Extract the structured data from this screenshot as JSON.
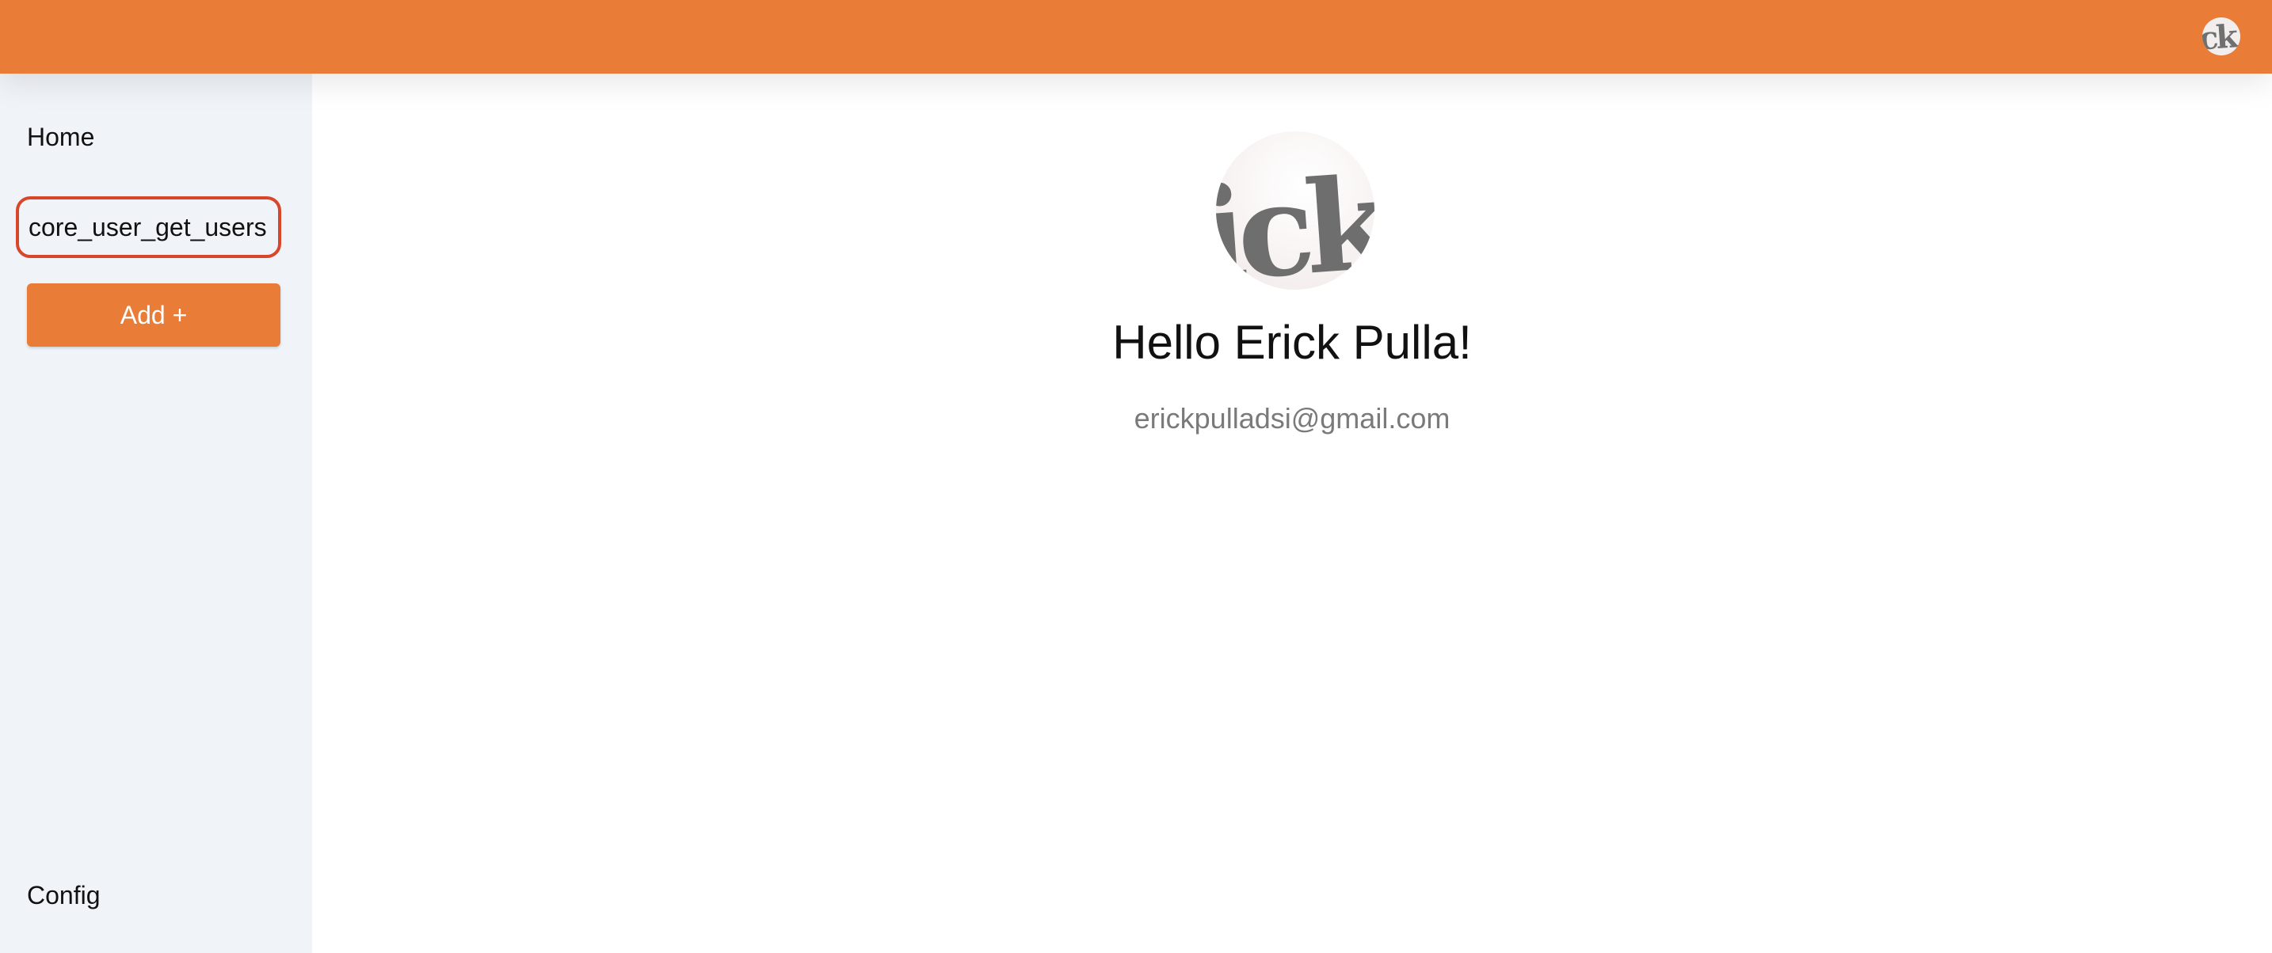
{
  "header": {
    "avatar_text": "ck",
    "color": "#E97C36"
  },
  "sidebar": {
    "items": [
      {
        "label": "Home"
      },
      {
        "label": "core_user_get_users"
      }
    ],
    "add_label": "Add +",
    "config_label": "Config",
    "highlight_color": "#D9472B"
  },
  "profile": {
    "avatar_text": "ick",
    "greeting": "Hello Erick Pulla!",
    "email": "erickpulladsi@gmail.com"
  }
}
